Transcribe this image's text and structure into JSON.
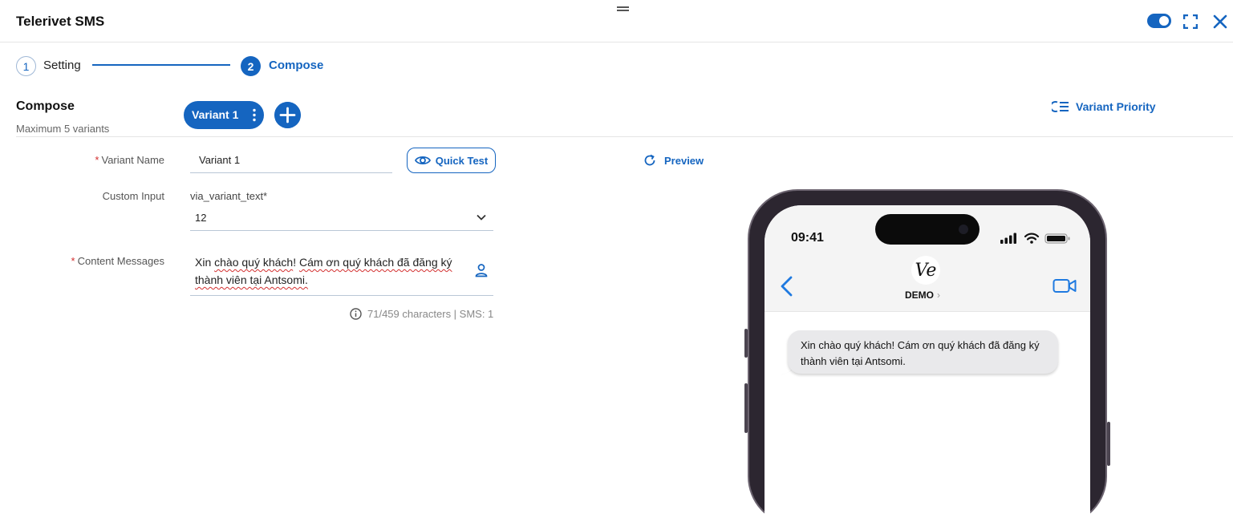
{
  "header": {
    "title": "Telerivet SMS",
    "toggle_on": true
  },
  "stepper": {
    "steps": [
      {
        "number": "1",
        "label": "Setting",
        "active": false
      },
      {
        "number": "2",
        "label": "Compose",
        "active": true
      }
    ]
  },
  "compose": {
    "title": "Compose",
    "subtitle": "Maximum 5 variants",
    "variant_chip": "Variant 1",
    "variant_priority_label": "Variant Priority"
  },
  "form": {
    "variant_name_label": "Variant Name",
    "variant_name_value": "Variant 1",
    "quick_test_label": "Quick Test",
    "custom_input_label": "Custom Input",
    "custom_input_key": "via_variant_text*",
    "custom_input_value": "12",
    "content_label": "Content Messages",
    "content_line1_a": "Xin ",
    "content_line1_b": "chào quý khách",
    "content_line1_c": "! ",
    "content_line1_d": "Cám ơn quý khách đã đăng ký",
    "content_line2": "thành viên tại Antsomi.",
    "char_count": "71/459 characters | SMS: 1"
  },
  "preview": {
    "label": "Preview",
    "time": "09:41",
    "avatar_text": "Ve",
    "contact_name": "DEMO",
    "contact_chevron": "›",
    "message_line1": "Xin chào quý khách! Cám ơn quý khách đã đăng ký",
    "message_line2": "thành viên tại Antsomi."
  },
  "colors": {
    "primary": "#1565c0",
    "required": "#d32f2f",
    "ios_blue": "#1f7ae0"
  }
}
